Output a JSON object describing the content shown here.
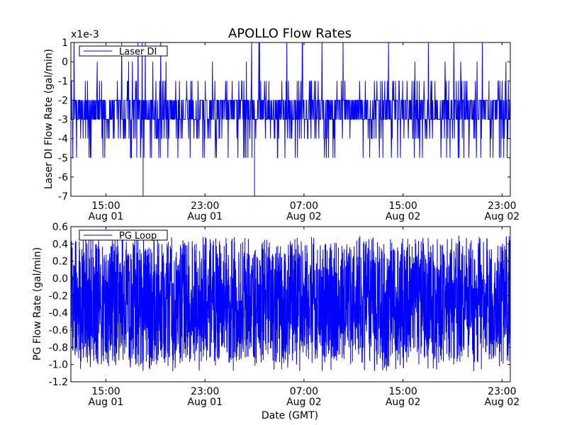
{
  "figure_title": "APOLLO Flow Rates",
  "colors": {
    "line": "#0000ff",
    "axes": "#000000",
    "background": "#ffffff"
  },
  "chart_data": [
    {
      "type": "line",
      "title": "APOLLO Flow Rates",
      "xlabel": "",
      "ylabel": "Laser DI Flow Rate (gal/min)",
      "offset_text": "x1e-3",
      "x_ticks": [
        {
          "time": "15:00",
          "date": "Aug 01"
        },
        {
          "time": "23:00",
          "date": "Aug 01"
        },
        {
          "time": "07:00",
          "date": "Aug 02"
        },
        {
          "time": "15:00",
          "date": "Aug 02"
        },
        {
          "time": "23:00",
          "date": "Aug 02"
        }
      ],
      "xlim": [
        "Aug 01 12:10",
        "Aug 02 23:40"
      ],
      "ylim": [
        -7,
        1
      ],
      "y_ticks": [
        "1",
        "0",
        "-1",
        "-2",
        "-3",
        "-4",
        "-5",
        "-6",
        "-7"
      ],
      "legend": {
        "label": "Laser DI",
        "position": "upper-left"
      },
      "grid": false,
      "series": [
        {
          "name": "Laser DI",
          "baseline": -2.5,
          "typical_range": [
            -3,
            -2
          ],
          "extreme_dips": [
            {
              "x": "Aug 01 18:00",
              "y": -7
            },
            {
              "x": "Aug 02 03:00",
              "y": -7
            }
          ],
          "spikes_to": 1
        }
      ]
    },
    {
      "type": "line",
      "xlabel": "Date (GMT)",
      "ylabel": "PG Flow Rate (gal/min)",
      "x_ticks": [
        {
          "time": "15:00",
          "date": "Aug 01"
        },
        {
          "time": "23:00",
          "date": "Aug 01"
        },
        {
          "time": "07:00",
          "date": "Aug 02"
        },
        {
          "time": "15:00",
          "date": "Aug 02"
        },
        {
          "time": "23:00",
          "date": "Aug 02"
        }
      ],
      "xlim": [
        "Aug 01 12:10",
        "Aug 02 23:40"
      ],
      "ylim": [
        -1.2,
        0.6
      ],
      "y_ticks": [
        "0.6",
        "0.4",
        "0.2",
        "0.0",
        "-0.2",
        "-0.4",
        "-0.6",
        "-0.8",
        "-1.0",
        "-1.2"
      ],
      "legend": {
        "label": "PG Loop",
        "position": "upper-left"
      },
      "grid": false,
      "series": [
        {
          "name": "PG Loop",
          "baseline": -0.2,
          "typical_range": [
            -1.0,
            0.45
          ],
          "max": 0.5,
          "min": -1.08
        }
      ]
    }
  ]
}
